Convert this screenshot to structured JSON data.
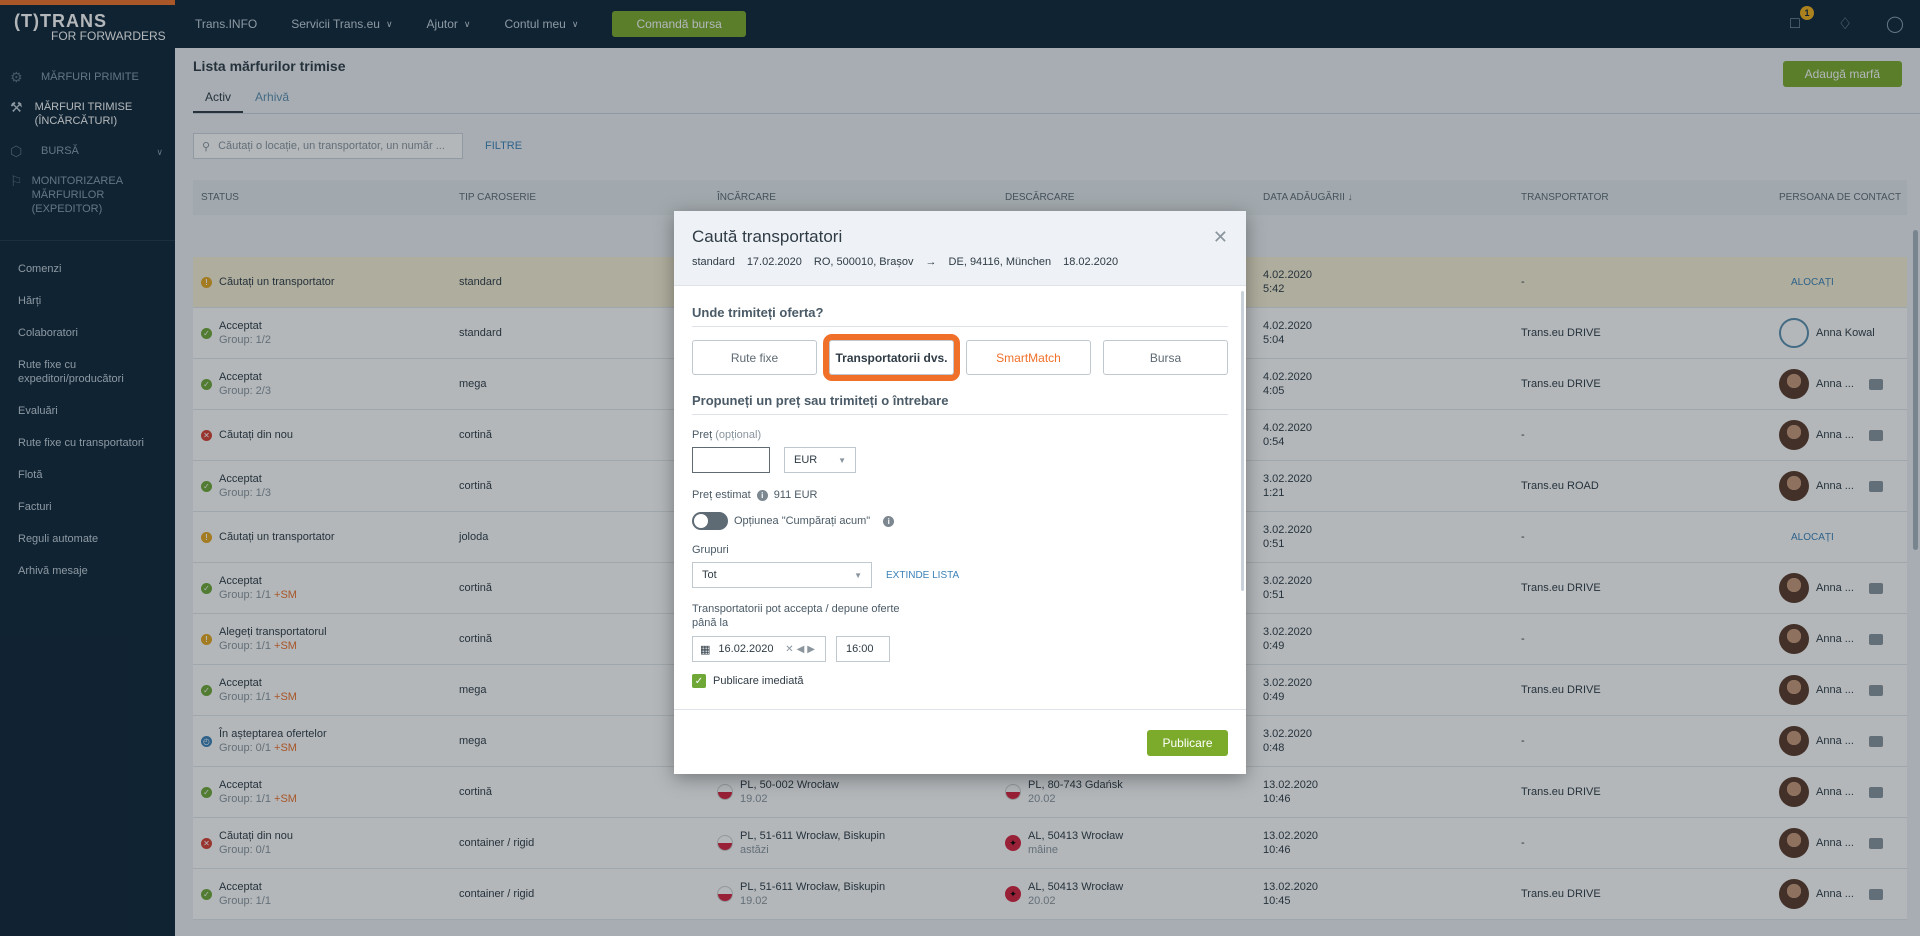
{
  "logo": {
    "line1": "(T)TRANS",
    "line2": "FOR FORWARDERS"
  },
  "nav": {
    "items": [
      {
        "label": "Trans.INFO",
        "has_dropdown": false
      },
      {
        "label": "Servicii Trans.eu",
        "has_dropdown": true
      },
      {
        "label": "Ajutor",
        "has_dropdown": true
      },
      {
        "label": "Contul meu",
        "has_dropdown": true
      }
    ],
    "cta_label": "Comandă bursa",
    "messages_badge": "1"
  },
  "sidebar": {
    "main_items": [
      {
        "label": "MĂRFURI PRIMITE",
        "icon": "goods-received-icon"
      },
      {
        "label": "MĂRFURI TRIMISE (ÎNCĂRCĂTURI)",
        "icon": "goods-sent-icon"
      },
      {
        "label": "BURSĂ",
        "icon": "exchange-icon"
      },
      {
        "label": "MONITORIZAREA MĂRFURILOR (EXPEDITOR)",
        "icon": "monitoring-icon"
      }
    ],
    "sub_items": [
      "Comenzi",
      "Hărți",
      "Colaboratori",
      "Rute fixe cu expeditori/producători",
      "Evaluări",
      "Rute fixe cu transportatori",
      "Flotă",
      "Facturi",
      "Reguli automate",
      "Arhivă mesaje"
    ]
  },
  "main": {
    "title": "Lista mărfurilor trimise",
    "tabs": [
      "Activ",
      "Arhivă"
    ],
    "add_button": "Adaugă marfă",
    "search_placeholder": "Căutați o locație, un transportator, un număr ...",
    "filters_link": "FILTRE",
    "columns": [
      "STATUS",
      "TIP CAROSERIE",
      "ÎNCĂRCARE",
      "DESCĂRCARE",
      "DATA ADĂUGĂRII ↓",
      "TRANSPORTATOR",
      "PERSOANA DE CONTACT"
    ],
    "rows": [
      {
        "status": "Căutați un transportator",
        "group": "",
        "sm": "",
        "kind": "warn",
        "body": "standard",
        "load_place": "",
        "load_date": "",
        "unload_place": "",
        "unload_date": "",
        "added_date": "4.02.2020",
        "added_time": "5:42",
        "carrier": "-",
        "contact": "",
        "contact_mode": "alloc",
        "alloc_label": "ALOCAȚI",
        "highlight": true
      },
      {
        "status": "Acceptat",
        "group": "Group: 1/2",
        "sm": "",
        "kind": "ok",
        "body": "standard",
        "load_place": "",
        "load_date": "",
        "unload_place": "",
        "unload_date": "",
        "added_date": "4.02.2020",
        "added_time": "5:04",
        "carrier": "Trans.eu DRIVE",
        "contact": "Anna Kowal",
        "contact_mode": "empty",
        "alloc_label": "",
        "highlight": false
      },
      {
        "status": "Acceptat",
        "group": "Group: 2/3",
        "sm": "",
        "kind": "ok",
        "body": "mega",
        "load_place": "",
        "load_date": "",
        "unload_place": "",
        "unload_date": "",
        "added_date": "4.02.2020",
        "added_time": "4:05",
        "carrier": "Trans.eu DRIVE",
        "contact": "Anna ...",
        "contact_mode": "photo",
        "alloc_label": "",
        "highlight": false
      },
      {
        "status": "Căutați din nou",
        "group": "",
        "sm": "",
        "kind": "err",
        "body": "cortină",
        "load_place": "",
        "load_date": "",
        "unload_place": "",
        "unload_date": "",
        "added_date": "4.02.2020",
        "added_time": "0:54",
        "carrier": "-",
        "contact": "Anna ...",
        "contact_mode": "photo",
        "alloc_label": "",
        "highlight": false
      },
      {
        "status": "Acceptat",
        "group": "Group: 1/3",
        "sm": "",
        "kind": "ok",
        "body": "cortină",
        "load_place": "",
        "load_date": "",
        "unload_place": "",
        "unload_date": "",
        "added_date": "3.02.2020",
        "added_time": "1:21",
        "carrier": "Trans.eu ROAD",
        "contact": "Anna ...",
        "contact_mode": "photo",
        "alloc_label": "",
        "highlight": false
      },
      {
        "status": "Căutați un transportator",
        "group": "",
        "sm": "",
        "kind": "warn",
        "body": "joloda",
        "load_place": "",
        "load_date": "",
        "unload_place": "",
        "unload_date": "",
        "added_date": "3.02.2020",
        "added_time": "0:51",
        "carrier": "-",
        "contact": "",
        "contact_mode": "alloc",
        "alloc_label": "ALOCAȚI",
        "highlight": false
      },
      {
        "status": "Acceptat",
        "group": "Group: 1/1",
        "sm": "+SM",
        "kind": "ok",
        "body": "cortină",
        "load_place": "",
        "load_date": "",
        "unload_place": "",
        "unload_date": "",
        "added_date": "3.02.2020",
        "added_time": "0:51",
        "carrier": "Trans.eu DRIVE",
        "contact": "Anna ...",
        "contact_mode": "photo",
        "alloc_label": "",
        "highlight": false
      },
      {
        "status": "Alegeți transportatorul",
        "group": "Group: 1/1",
        "sm": "+SM",
        "kind": "warn",
        "body": "cortină",
        "load_place": "",
        "load_date": "",
        "unload_place": "",
        "unload_date": "",
        "added_date": "3.02.2020",
        "added_time": "0:49",
        "carrier": "-",
        "contact": "Anna ...",
        "contact_mode": "photo",
        "alloc_label": "",
        "highlight": false
      },
      {
        "status": "Acceptat",
        "group": "Group: 1/1",
        "sm": "+SM",
        "kind": "ok",
        "body": "mega",
        "load_place": "",
        "load_date": "",
        "unload_place": "",
        "unload_date": "",
        "added_date": "3.02.2020",
        "added_time": "0:49",
        "carrier": "Trans.eu DRIVE",
        "contact": "Anna ...",
        "contact_mode": "photo",
        "alloc_label": "",
        "highlight": false
      },
      {
        "status": "În așteptarea ofertelor",
        "group": "Group: 0/1",
        "sm": "+SM",
        "kind": "wait",
        "body": "mega",
        "load_place": "",
        "load_date": "",
        "unload_place": "",
        "unload_date": "",
        "added_date": "3.02.2020",
        "added_time": "0:48",
        "carrier": "-",
        "contact": "Anna ...",
        "contact_mode": "photo",
        "alloc_label": "",
        "highlight": false
      },
      {
        "status": "Acceptat",
        "group": "Group: 1/1",
        "sm": "+SM",
        "kind": "ok",
        "body": "cortină",
        "load_place": "PL, 50-002 Wrocław",
        "load_date": "19.02",
        "load_flag": "pl",
        "unload_place": "PL, 80-743 Gdańsk",
        "unload_date": "20.02",
        "unload_flag": "pl",
        "added_date": "13.02.2020",
        "added_time": "10:46",
        "carrier": "Trans.eu DRIVE",
        "contact": "Anna ...",
        "contact_mode": "photo",
        "alloc_label": "",
        "highlight": false
      },
      {
        "status": "Căutați din nou",
        "group": "Group: 0/1",
        "sm": "",
        "kind": "err",
        "body": "container / rigid",
        "load_place": "PL, 51-611 Wrocław, Biskupin",
        "load_date": "astăzi",
        "load_flag": "pl",
        "unload_place": "AL, 50413 Wrocław",
        "unload_date": "mâine",
        "unload_flag": "al",
        "added_date": "13.02.2020",
        "added_time": "10:46",
        "carrier": "-",
        "contact": "Anna ...",
        "contact_mode": "photo",
        "alloc_label": "",
        "highlight": false
      },
      {
        "status": "Acceptat",
        "group": "Group: 1/1",
        "sm": "",
        "kind": "ok",
        "body": "container / rigid",
        "load_place": "PL, 51-611 Wrocław, Biskupin",
        "load_date": "19.02",
        "load_flag": "pl",
        "unload_place": "AL, 50413 Wrocław",
        "unload_date": "20.02",
        "unload_flag": "al",
        "added_date": "13.02.2020",
        "added_time": "10:45",
        "carrier": "Trans.eu DRIVE",
        "contact": "Anna ...",
        "contact_mode": "photo",
        "alloc_label": "",
        "highlight": false
      }
    ]
  },
  "modal": {
    "title": "Caută transportatori",
    "route": {
      "body": "standard",
      "load_date": "17.02.2020",
      "from": "RO, 500010, Brașov",
      "to": "DE, 94116, München",
      "unload_date": "18.02.2020"
    },
    "section1_title": "Unde trimiteți oferta?",
    "targets": [
      "Rute fixe",
      "Transportatorii dvs.",
      "SmartMatch",
      "Bursa"
    ],
    "selected_target": "Transportatorii dvs.",
    "section2_title": "Propuneți un preț sau trimiteți o întrebare",
    "price_label": "Preț",
    "price_optional": "(opțional)",
    "price_value": "",
    "currency": "EUR",
    "estimated_label": "Preț estimat",
    "estimated_value": "911 EUR",
    "buy_now_label": "Opțiunea \"Cumpărați acum\"",
    "buy_now_on": false,
    "groups_label": "Grupuri",
    "groups_value": "Tot",
    "extend_link": "EXTINDE LISTA",
    "deadline_label_1": "Transportatorii pot accepta / depune oferte",
    "deadline_label_2": "până la",
    "deadline_date": "16.02.2020",
    "deadline_time": "16:00",
    "publish_now_label": "Publicare imediată",
    "publish_now_checked": true,
    "publish_button": "Publicare"
  },
  "colors": {
    "accent_green": "#7cab2b",
    "highlight_orange": "#f0702a",
    "nav_bg": "#0f2638"
  }
}
